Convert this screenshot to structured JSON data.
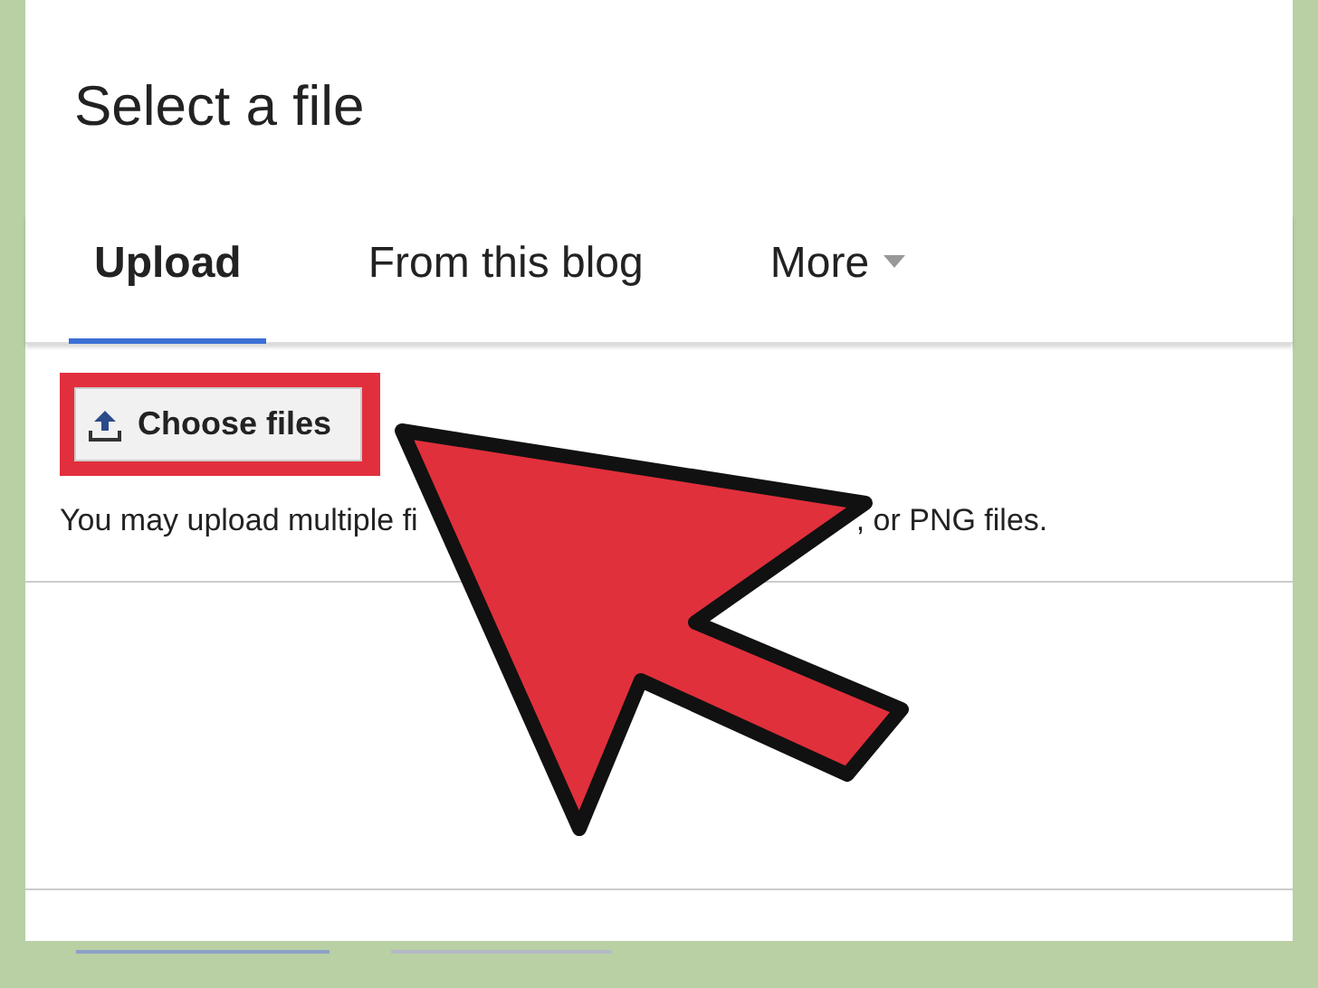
{
  "dialog": {
    "title": "Select a file"
  },
  "tabs": [
    {
      "label": "Upload",
      "selected": true,
      "kind": "plain"
    },
    {
      "label": "From this blog",
      "selected": false,
      "kind": "plain"
    },
    {
      "label": "More",
      "selected": false,
      "kind": "dropdown"
    }
  ],
  "upload": {
    "button": "Choose files",
    "highlighted": true,
    "note_start": "You may upload multiple fi",
    "note_end": ", or PNG files."
  },
  "annotation": {
    "kind": "arrow"
  }
}
